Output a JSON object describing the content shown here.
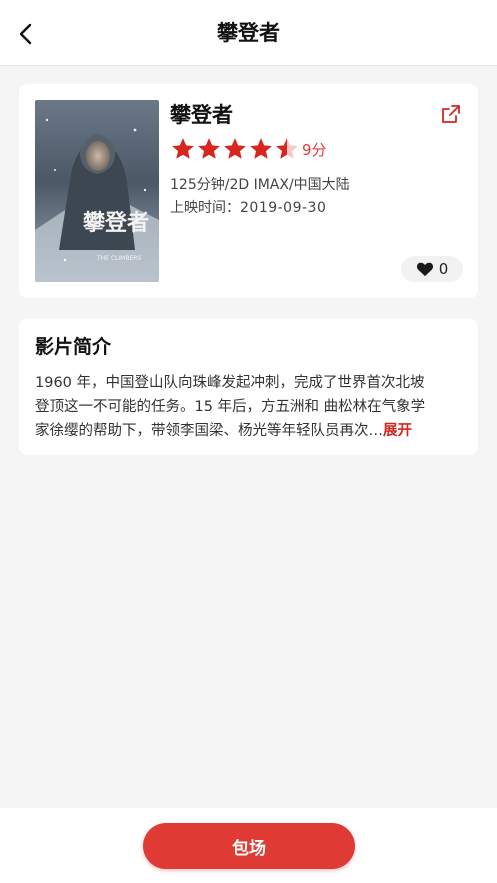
{
  "header": {
    "title": "攀登者",
    "back_icon": "chevron-left-icon"
  },
  "movie": {
    "title": "攀登者",
    "rating": {
      "stars_filled": 4.5,
      "stars_total": 5,
      "score": "9分"
    },
    "info_line": "125分钟/2D IMAX/中国大陆",
    "release_label": "上映时间：",
    "release_date": "2019-09-30",
    "likes": "0",
    "share_icon": "share-icon",
    "like_icon": "heart-icon",
    "poster": {
      "title_text": "攀登者",
      "subtitle_text": "THE CLIMBERS"
    }
  },
  "synopsis": {
    "heading": "影片简介",
    "lines": [
      "1960 年，中国登山队向珠峰发起冲刺，完成了世界首次北坡",
      "登顶这一不可能的任务。15 年后，方五洲和 曲松林在气象学",
      "家徐缨的帮助下，带领李国梁、杨光等年轻队员再次…"
    ],
    "expand_label": "展开"
  },
  "footer": {
    "book_label": "包场"
  },
  "colors": {
    "accent": "#e03a35",
    "star": "#d6261f",
    "background": "#f5f5f5",
    "card": "#ffffff"
  }
}
